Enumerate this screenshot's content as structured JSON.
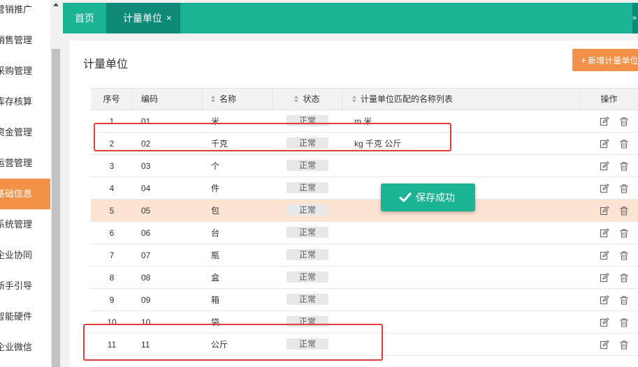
{
  "sidebar": {
    "items": [
      {
        "label": "营销推广",
        "active": false
      },
      {
        "label": "销售管理",
        "active": false
      },
      {
        "label": "采购管理",
        "active": false
      },
      {
        "label": "库存核算",
        "active": false
      },
      {
        "label": "资金管理",
        "active": false
      },
      {
        "label": "运营管理",
        "active": false
      },
      {
        "label": "基础信息",
        "active": true
      },
      {
        "label": "系统管理",
        "active": false
      },
      {
        "label": "企业协同",
        "active": false
      },
      {
        "label": "新手引导",
        "active": false
      },
      {
        "label": "智能硬件",
        "active": false
      },
      {
        "label": "企业微信",
        "active": false
      }
    ]
  },
  "tabs": {
    "home_label": "首页",
    "active_label": "计量单位",
    "close_label": "×"
  },
  "page": {
    "title": "计量单位",
    "add_button_label": "新增计量单位",
    "add_button_plus": "+"
  },
  "table": {
    "headers": {
      "index": "序号",
      "code": "编码",
      "name": "名称",
      "status": "状态",
      "alias": "计量单位匹配的名称列表",
      "ops": "操作"
    },
    "rows": [
      {
        "index": "1",
        "code": "01",
        "name": "米",
        "status": "正常",
        "alias": "m 米"
      },
      {
        "index": "2",
        "code": "02",
        "name": "千克",
        "status": "正常",
        "alias": "kg 千克 公斤"
      },
      {
        "index": "3",
        "code": "03",
        "name": "个",
        "status": "正常",
        "alias": ""
      },
      {
        "index": "4",
        "code": "04",
        "name": "件",
        "status": "正常",
        "alias": ""
      },
      {
        "index": "5",
        "code": "05",
        "name": "包",
        "status": "正常",
        "alias": ""
      },
      {
        "index": "6",
        "code": "06",
        "name": "台",
        "status": "正常",
        "alias": ""
      },
      {
        "index": "7",
        "code": "07",
        "name": "瓶",
        "status": "正常",
        "alias": ""
      },
      {
        "index": "8",
        "code": "08",
        "name": "盒",
        "status": "正常",
        "alias": ""
      },
      {
        "index": "9",
        "code": "09",
        "name": "箱",
        "status": "正常",
        "alias": ""
      },
      {
        "index": "10",
        "code": "10",
        "name": "袋",
        "status": "正常",
        "alias": ""
      },
      {
        "index": "11",
        "code": "11",
        "name": "公斤",
        "status": "正常",
        "alias": ""
      }
    ],
    "highlighted_row": 5
  },
  "toast": {
    "message": "保存成功"
  },
  "colors": {
    "accent": "#1ab394",
    "tab_active": "#0f8a78",
    "orange": "#f39149",
    "highlight_row": "#fde3d1",
    "annotation_red": "#e03c3c"
  },
  "icons": {
    "edit": "edit-icon",
    "delete": "trash-icon",
    "toast": "check-icon",
    "sort": "sort-icon"
  }
}
